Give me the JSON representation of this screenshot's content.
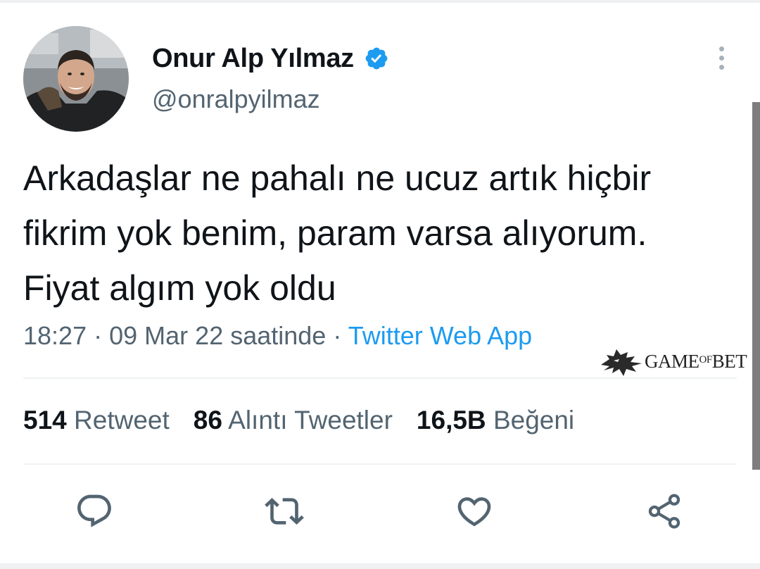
{
  "tweet": {
    "author": {
      "display_name": "Onur Alp Yılmaz",
      "handle": "@onralpyilmaz",
      "verified": true
    },
    "text": "Arkadaşlar ne pahalı ne ucuz artık hiçbir fikrim yok benim, param varsa alıyorum. Fiyat algım yok oldu",
    "time": "18:27",
    "date_text": "09 Mar 22 saatinde",
    "separator": "·",
    "source": "Twitter Web App",
    "stats": {
      "retweets_value": "514",
      "retweets_label": "Retweet",
      "quotes_value": "86",
      "quotes_label": "Alıntı Tweetler",
      "likes_value": "16,5B",
      "likes_label": "Beğeni"
    }
  },
  "watermark": {
    "text_main": "GAME",
    "text_small": "OF",
    "text_end": "BET"
  },
  "actions": [
    "reply-icon",
    "retweet-icon",
    "like-icon",
    "share-icon"
  ],
  "colors": {
    "primary_text": "#0f1419",
    "secondary_text": "#536471",
    "link": "#1d9bf0",
    "verified": "#1d9bf0",
    "icon": "#536471"
  }
}
